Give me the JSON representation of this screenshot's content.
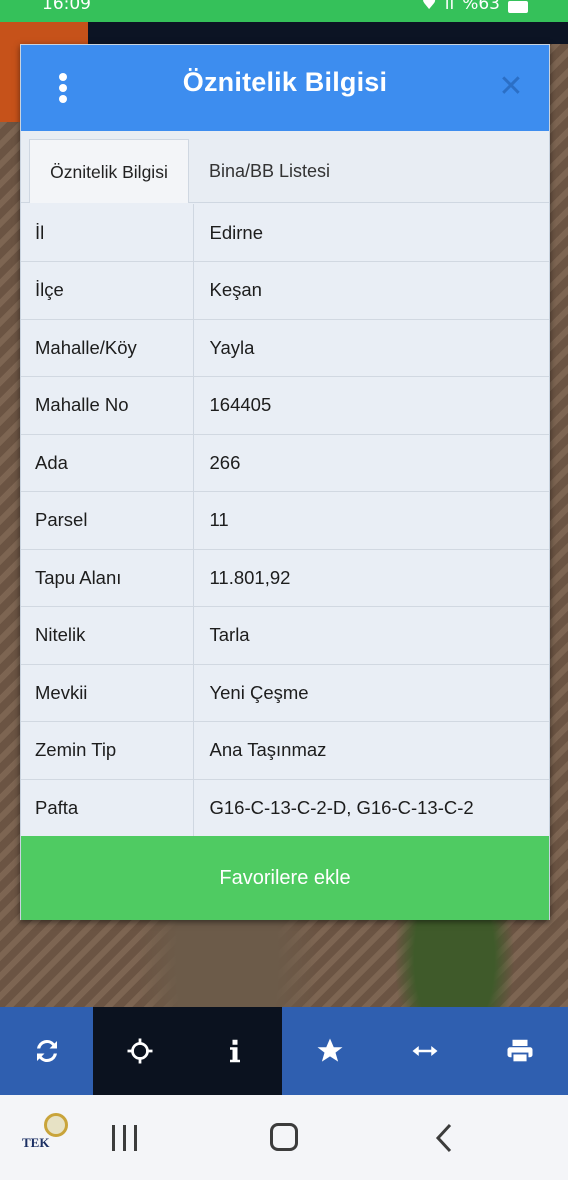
{
  "status_bar": {
    "time": "16:09",
    "battery": "%63"
  },
  "dialog": {
    "title": "Öznitelik Bilgisi",
    "tabs": [
      {
        "label": "Öznitelik Bilgisi",
        "active": true
      },
      {
        "label": "Bina/BB Listesi",
        "active": false
      }
    ],
    "rows": [
      {
        "key": "İl",
        "value": "Edirne"
      },
      {
        "key": "İlçe",
        "value": "Keşan"
      },
      {
        "key": "Mahalle/Köy",
        "value": "Yayla"
      },
      {
        "key": "Mahalle No",
        "value": "164405"
      },
      {
        "key": "Ada",
        "value": "266"
      },
      {
        "key": "Parsel",
        "value": "11"
      },
      {
        "key": "Tapu Alanı",
        "value": "11.801,92"
      },
      {
        "key": "Nitelik",
        "value": "Tarla"
      },
      {
        "key": "Mevkii",
        "value": "Yeni Çeşme"
      },
      {
        "key": "Zemin Tip",
        "value": "Ana Taşınmaz"
      },
      {
        "key": "Pafta",
        "value": "G16-C-13-C-2-D, G16-C-13-C-2"
      }
    ],
    "favorite_button": "Favorilere ekle"
  },
  "toolbar": {
    "items": [
      {
        "icon": "refresh-icon"
      },
      {
        "icon": "crosshair-icon"
      },
      {
        "icon": "info-icon"
      },
      {
        "icon": "star-icon"
      },
      {
        "icon": "measure-icon"
      },
      {
        "icon": "print-icon"
      }
    ]
  },
  "nav_bar": {
    "logo_text": "TEK"
  },
  "colors": {
    "header_blue": "#3d8def",
    "favorite_green": "#4fcb62",
    "toolbar_blue": "#2f5fb0",
    "status_green": "#35c15a"
  }
}
